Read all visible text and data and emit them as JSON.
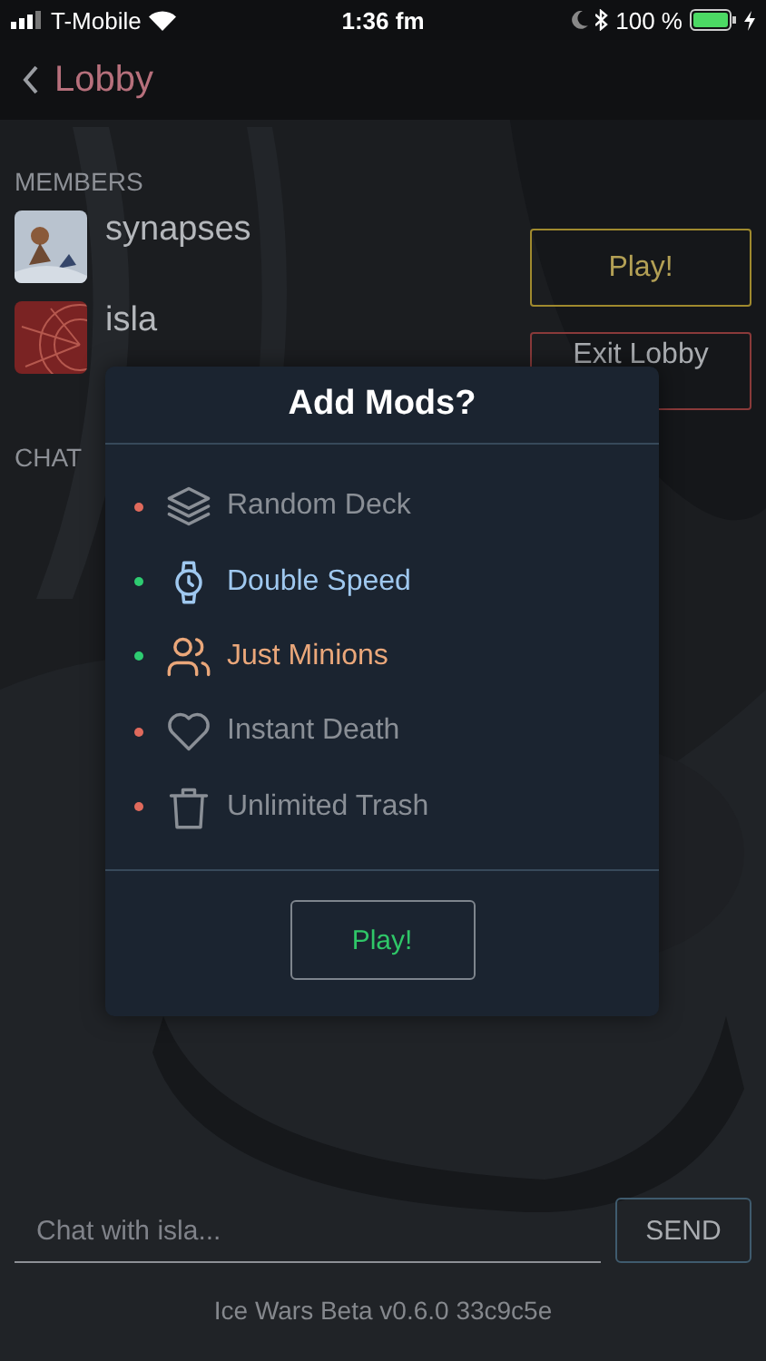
{
  "status_bar": {
    "carrier": "T-Mobile",
    "time": "1:36 fm",
    "battery": "100 %"
  },
  "nav": {
    "back_label": "Lobby"
  },
  "members_heading": "MEMBERS",
  "members": [
    {
      "name": "synapses"
    },
    {
      "name": "isla"
    }
  ],
  "actions": [
    {
      "label": "Play!",
      "kind": "play"
    },
    {
      "label": "Exit Lobby",
      "kind": "exit"
    }
  ],
  "chat_heading": "CHAT",
  "modal": {
    "title": "Add Mods?",
    "mods": [
      {
        "label": "Random Deck",
        "kind": "layers",
        "enabled": false,
        "color": "#8a8f96"
      },
      {
        "label": "Double Speed",
        "kind": "watch",
        "enabled": true,
        "color": "#9fc8ef"
      },
      {
        "label": "Just Minions",
        "kind": "people",
        "enabled": true,
        "color": "#eaa77a"
      },
      {
        "label": "Instant Death",
        "kind": "heart",
        "enabled": false,
        "color": "#8a8f96"
      },
      {
        "label": "Unlimited Trash",
        "kind": "trash",
        "enabled": false,
        "color": "#8a8f96"
      }
    ],
    "button": "Play!"
  },
  "chat": {
    "placeholder": "Chat with isla...",
    "send": "SEND"
  },
  "footer": "Ice Wars Beta v0.6.0 33c9c5e"
}
